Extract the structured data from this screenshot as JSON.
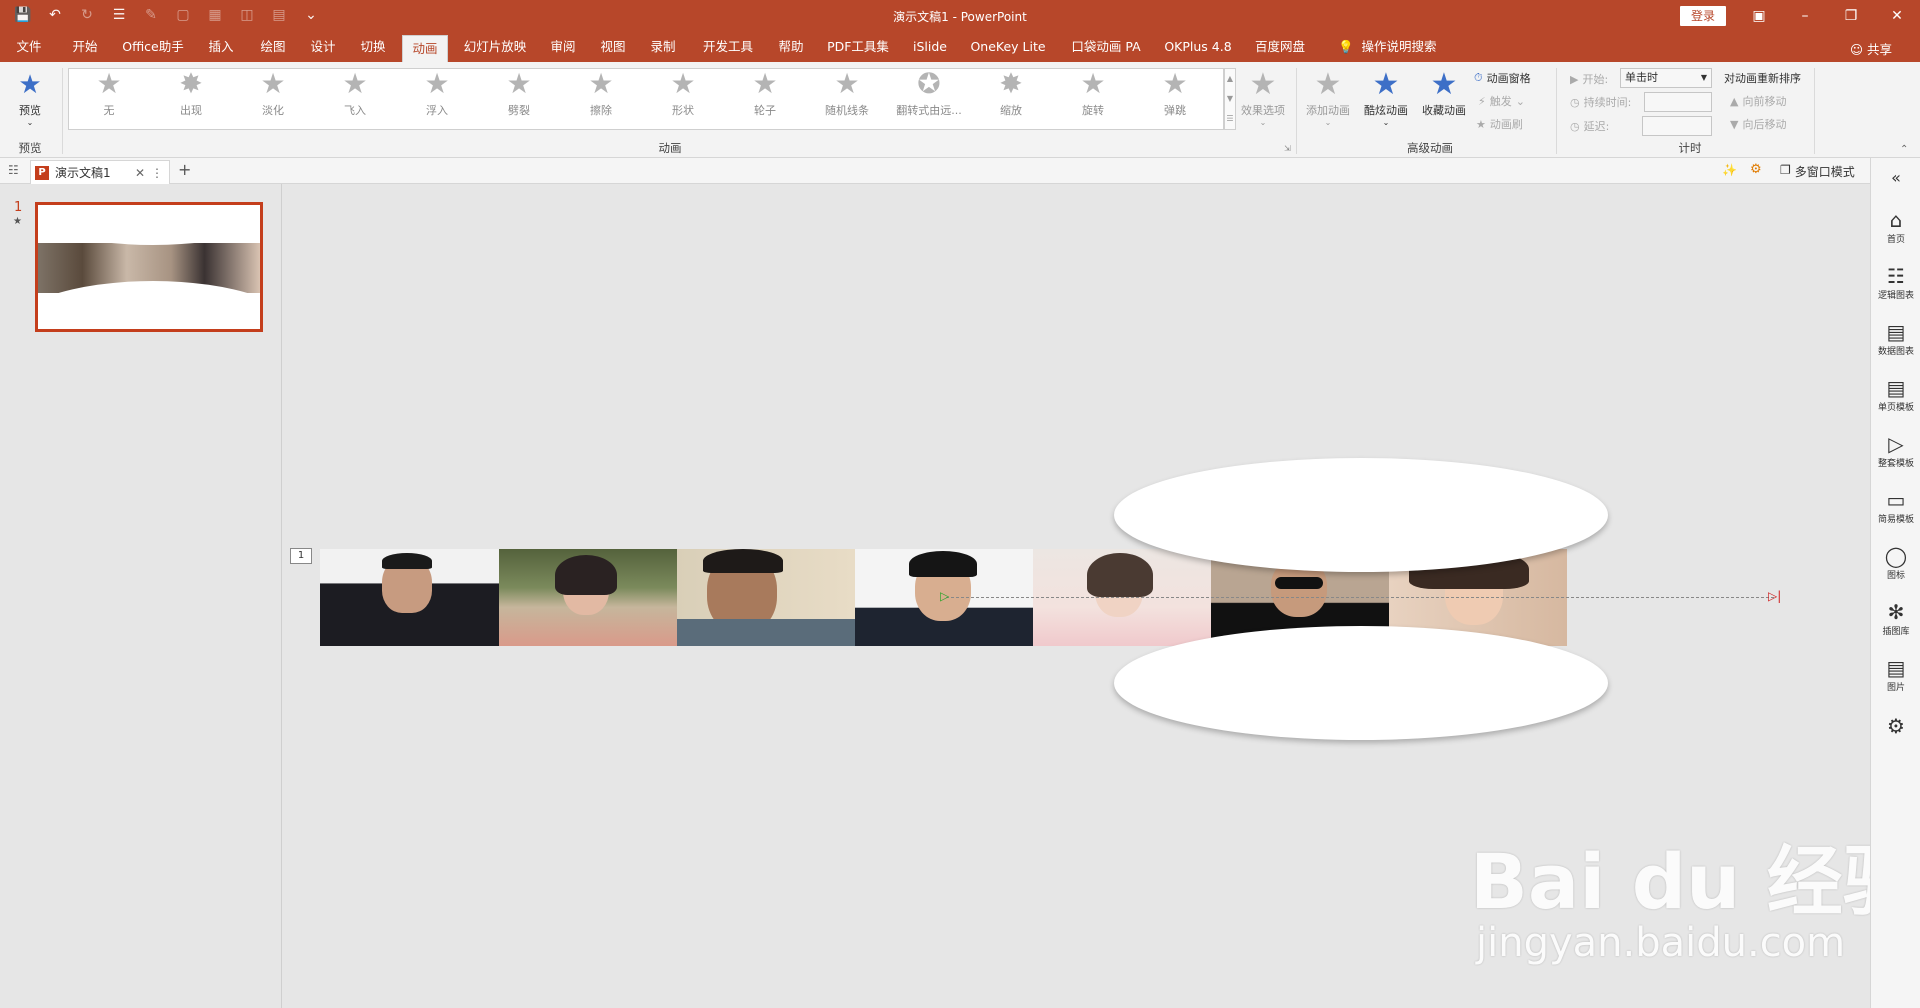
{
  "app": {
    "title": "演示文稿1 - PowerPoint",
    "login": "登录"
  },
  "menu": {
    "tabs": [
      "文件",
      "开始",
      "Office助手",
      "插入",
      "绘图",
      "设计",
      "切换",
      "动画",
      "幻灯片放映",
      "审阅",
      "视图",
      "录制",
      "开发工具",
      "帮助",
      "PDF工具集",
      "iSlide",
      "OneKey Lite",
      "口袋动画 PA",
      "OKPlus 4.8",
      "百度网盘",
      "操作说明搜索"
    ],
    "active": "动画",
    "share": "共享"
  },
  "ribbon": {
    "preview": {
      "label": "预览",
      "group": "预览"
    },
    "animations": [
      "无",
      "出现",
      "淡化",
      "飞入",
      "浮入",
      "劈裂",
      "擦除",
      "形状",
      "轮子",
      "随机线条",
      "翻转式由远...",
      "缩放",
      "旋转",
      "弹跳"
    ],
    "effect_options": "效果选项",
    "group_animation": "动画",
    "add_animation": "添加动画",
    "cool_animation": "酷炫动画",
    "fav_animation": "收藏动画",
    "anim_pane": "动画窗格",
    "trigger": "触发",
    "anim_painter": "动画刷",
    "group_advanced": "高级动画",
    "start_label": "开始:",
    "start_value": "单击时",
    "duration_label": "持续时间:",
    "delay_label": "延迟:",
    "group_timing": "计时",
    "reorder": "对动画重新排序",
    "move_earlier": "向前移动",
    "move_later": "向后移动"
  },
  "doc_tabs": {
    "name": "演示文稿1",
    "multi_window": "多窗口模式"
  },
  "slides": {
    "number": "1",
    "star": "★"
  },
  "slide": {
    "anim_index": "1"
  },
  "right_panel": [
    "首页",
    "逻辑图表",
    "数据图表",
    "单页模板",
    "整套模板",
    "简易模板",
    "图标",
    "插图库",
    "图片"
  ],
  "watermark": {
    "brand": "Bai du 经验",
    "url": "jingyan.baidu.com"
  },
  "colors": {
    "accent": "#b7472a",
    "star_blue": "#3d6fc7"
  }
}
